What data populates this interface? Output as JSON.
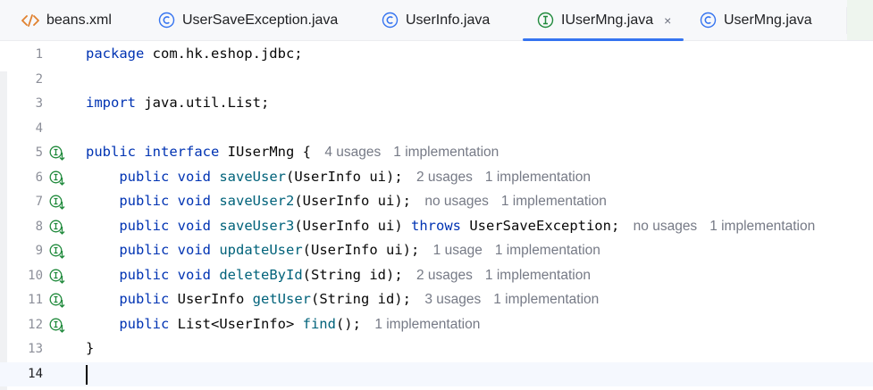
{
  "tabs": [
    {
      "label": "beans.xml",
      "icon": "xml-tag-icon",
      "icon_color": "#e0812f",
      "active": false
    },
    {
      "label": "UserSaveException.java",
      "icon": "class-c-icon",
      "icon_color": "#3574f0",
      "active": false
    },
    {
      "label": "UserInfo.java",
      "icon": "class-c-icon",
      "icon_color": "#3574f0",
      "active": false
    },
    {
      "label": "IUserMng.java",
      "icon": "interface-i-icon",
      "icon_color": "#208a3c",
      "active": true,
      "close": "×"
    },
    {
      "label": "UserMng.java",
      "icon": "class-c-icon",
      "icon_color": "#3574f0",
      "active": false
    }
  ],
  "editor": {
    "line_numbers": [
      "1",
      "2",
      "3",
      "4",
      "5",
      "6",
      "7",
      "8",
      "9",
      "10",
      "11",
      "12",
      "13",
      "14"
    ],
    "lines": {
      "l1": {
        "kw": "package",
        "rest": " com.hk.eshop.jdbc;"
      },
      "l3": {
        "kw": "import",
        "rest": " java.util.List;"
      },
      "l5": {
        "kw1": "public",
        "kw2": "interface",
        "rest": " IUserMng {",
        "hint1": "4 usages",
        "hint2": "1 implementation"
      },
      "l6": {
        "public": "public",
        "void": "void",
        "fn": "saveUser",
        "args": "(UserInfo ui);",
        "hint1": "2 usages",
        "hint2": "1 implementation"
      },
      "l7": {
        "public": "public",
        "void": "void",
        "fn": "saveUser2",
        "args": "(UserInfo ui);",
        "hint1": "no usages",
        "hint2": "1 implementation"
      },
      "l8": {
        "public": "public",
        "void": "void",
        "fn": "saveUser3",
        "args": "(UserInfo ui) ",
        "throws": "throws",
        "exc": " UserSaveException;",
        "hint1": "no usages",
        "hint2": "1 implementation"
      },
      "l9": {
        "public": "public",
        "void": "void",
        "fn": "updateUser",
        "args": "(UserInfo ui);",
        "hint1": "1 usage",
        "hint2": "1 implementation"
      },
      "l10": {
        "public": "public",
        "void": "void",
        "fn": "deleteById",
        "args": "(String id);",
        "hint1": "2 usages",
        "hint2": "1 implementation"
      },
      "l11": {
        "public": "public",
        "type": " UserInfo ",
        "fn": "getUser",
        "args": "(String id);",
        "hint1": "3 usages",
        "hint2": "1 implementation"
      },
      "l12": {
        "public": "public",
        "type": " List<UserInfo> ",
        "fn": "find",
        "args": "();",
        "hint1": "1 implementation"
      },
      "l13": {
        "text": "}"
      }
    },
    "gutter_icon": "implemented-interface-icon",
    "gutter_icon_color": "#208a3c",
    "keyword_color": "#0033b3",
    "method_color": "#00627a",
    "hint_color": "#767a86"
  }
}
